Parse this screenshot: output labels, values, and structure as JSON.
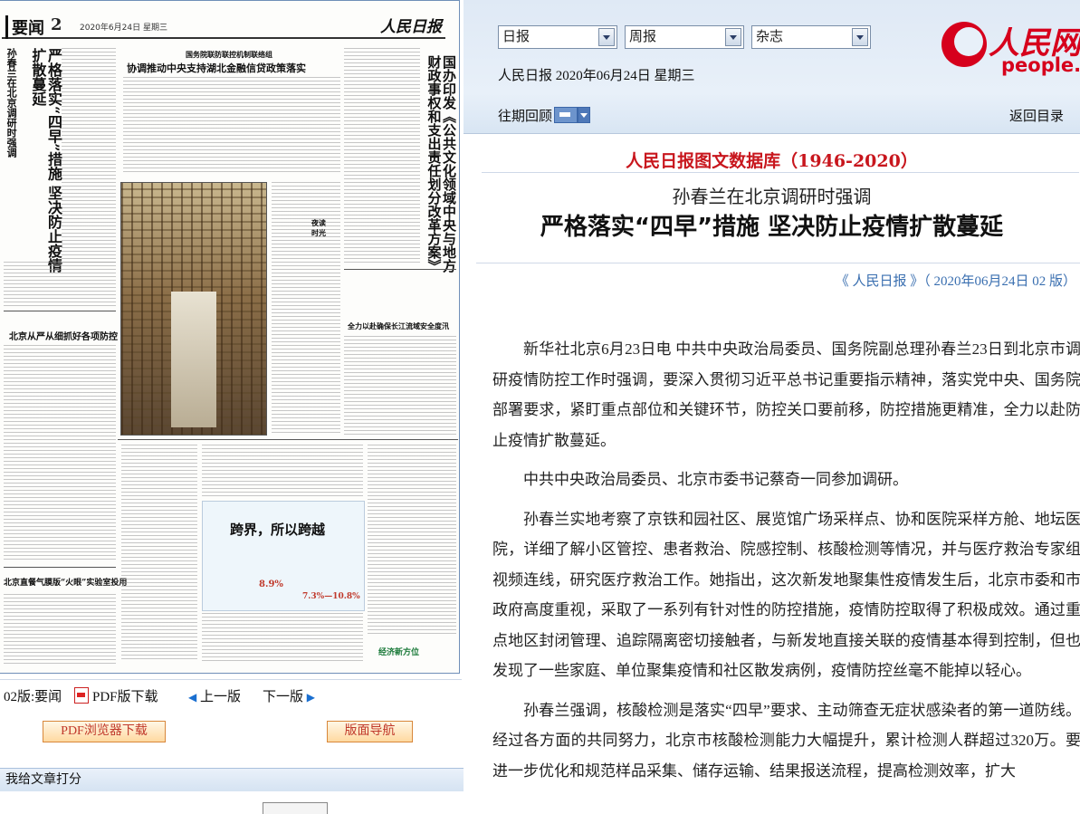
{
  "newspaper": {
    "section": "要闻",
    "page": "2",
    "date": "2020年6月24日 星期三",
    "masthead": "人民日报",
    "lead_kicker": "孙春兰在北京调研时强调",
    "lead_title": "严格落实“四早”措施 坚决防止疫情扩散蔓延",
    "headline_center": "协调推动中央支持湖北金融信贷政策落实",
    "kicker_center": "国务院联防联控机制联络组",
    "vertical_right": "国办印发《公共文化领域中央与地方财政事权和支出责任划分改革方案》",
    "small_head_1": "北京从严从细抓好各项防控",
    "small_head_2": "北京直餐气膜版“火眼”实验室投用",
    "small_head_3": "全力以赴确保长江流域安全度汛",
    "infographic_title": "跨界，所以跨越",
    "infographic_stat_1": "8.9%",
    "infographic_stat_2": "7.3%—10.8%",
    "night_label": "夜读 时光",
    "footer_badge": "经济新方位"
  },
  "left_controls": {
    "page_label": "02版:要闻",
    "pdf_download": "PDF版下载",
    "prev_page": "上一版",
    "next_page": "下一版",
    "pdf_browser_download": "PDF浏览器下载",
    "layout_nav": "版面导航",
    "rate_article": "我给文章打分"
  },
  "top_nav": {
    "select_1": "日报",
    "select_2": "周报",
    "select_3": "杂志",
    "date_line": "人民日报 2020年06月24日 星期三",
    "past_issues": "往期回顾",
    "return_toc": "返回目录",
    "logo_cn": "人民网",
    "logo_en": "people.cn"
  },
  "article": {
    "database_title": "人民日报图文数据库（1946-2020）",
    "kicker": "孙春兰在北京调研时强调",
    "headline": "严格落实“四早”措施 坚决防止疫情扩散蔓延",
    "source": "《 人民日报 》（ 2020年06月24日   02 版）",
    "paragraphs": [
      "新华社北京6月23日电  中共中央政治局委员、国务院副总理孙春兰23日到北京市调研疫情防控工作时强调，要深入贯彻习近平总书记重要指示精神，落实党中央、国务院部署要求，紧盯重点部位和关键环节，防控关口要前移，防控措施更精准，全力以赴防止疫情扩散蔓延。",
      "中共中央政治局委员、北京市委书记蔡奇一同参加调研。",
      "孙春兰实地考察了京铁和园社区、展览馆广场采样点、协和医院采样方舱、地坛医院，详细了解小区管控、患者救治、院感控制、核酸检测等情况，并与医疗救治专家组视频连线，研究医疗救治工作。她指出，这次新发地聚集性疫情发生后，北京市委和市政府高度重视，采取了一系列有针对性的防控措施，疫情防控取得了积极成效。通过重点地区封闭管理、追踪隔离密切接触者，与新发地直接关联的疫情基本得到控制，但也发现了一些家庭、单位聚集疫情和社区散发病例，疫情防控丝毫不能掉以轻心。",
      "孙春兰强调，核酸检测是落实“四早”要求、主动筛查无症状感染者的第一道防线。经过各方面的共同努力，北京市核酸检测能力大幅提升，累计检测人群超过320万。要进一步优化和规范样品采集、储存运输、结果报送流程，提高检测效率，扩大"
    ]
  },
  "colors": {
    "accent_red": "#c8161d",
    "link_blue": "#3a6fb0",
    "nav_bg": "#dfe9f5",
    "button_orange": "#d8873a"
  }
}
